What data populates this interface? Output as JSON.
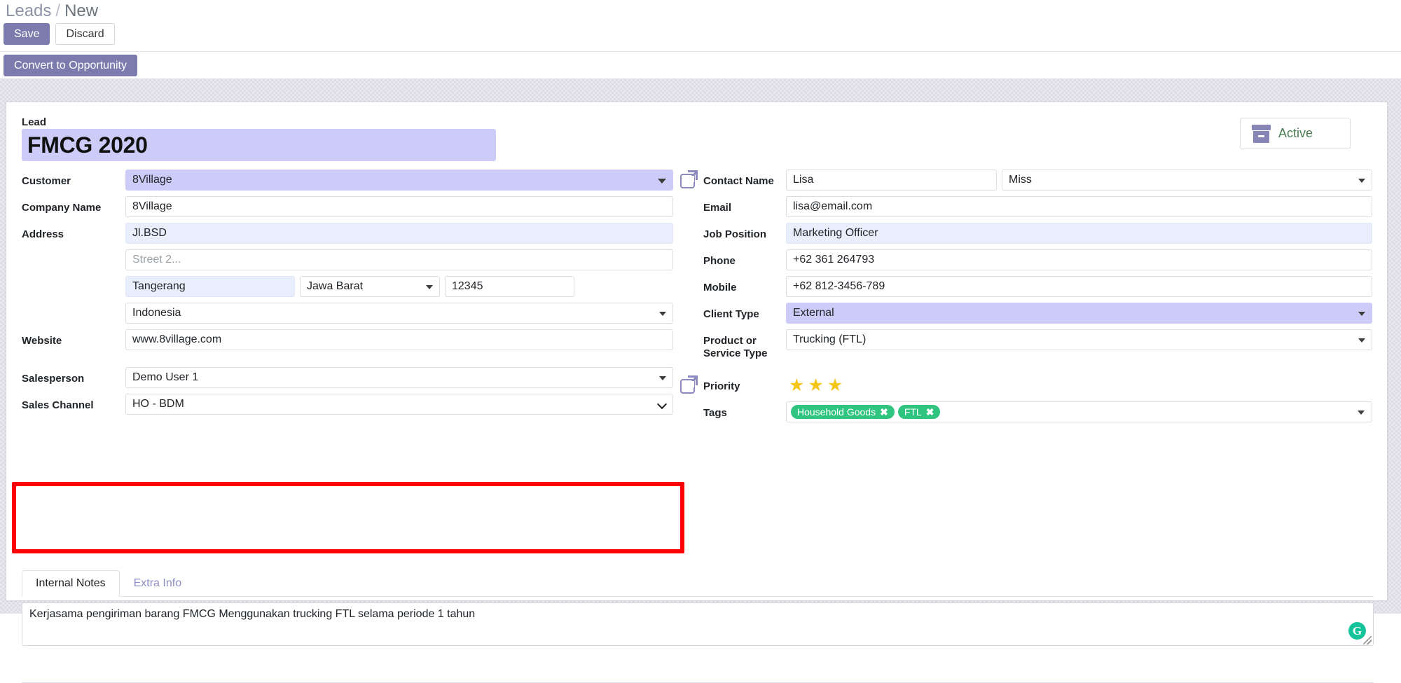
{
  "breadcrumb": {
    "root": "Leads",
    "separator": "/",
    "current": "New"
  },
  "control_panel": {
    "save_label": "Save",
    "discard_label": "Discard"
  },
  "action_bar": {
    "convert_label": "Convert to Opportunity"
  },
  "status": {
    "label": "Active",
    "icon": "archive-box-icon",
    "color": "#4a7a50"
  },
  "lead": {
    "label": "Lead",
    "name": "FMCG 2020"
  },
  "left_column": {
    "customer": {
      "label": "Customer",
      "value": "8Village"
    },
    "company_name": {
      "label": "Company Name",
      "value": "8Village"
    },
    "address": {
      "label": "Address",
      "street": "Jl.BSD",
      "street2_placeholder": "Street 2...",
      "city": "Tangerang",
      "state": "Jawa Barat",
      "zip": "12345",
      "country": "Indonesia"
    },
    "website": {
      "label": "Website",
      "value": "www.8village.com"
    },
    "salesperson": {
      "label": "Salesperson",
      "value": "Demo User 1"
    },
    "sales_channel": {
      "label": "Sales Channel",
      "value": "HO - BDM"
    }
  },
  "right_column": {
    "contact_name": {
      "label": "Contact Name",
      "value": "Lisa",
      "title": "Miss",
      "icon": "external-link-icon"
    },
    "email": {
      "label": "Email",
      "value": "lisa@email.com"
    },
    "job_position": {
      "label": "Job Position",
      "value": "Marketing Officer"
    },
    "phone": {
      "label": "Phone",
      "value": "+62 361 264793"
    },
    "mobile": {
      "label": "Mobile",
      "value": "+62 812-3456-789"
    },
    "client_type": {
      "label": "Client Type",
      "value": "External"
    },
    "product_service_type": {
      "label": "Product or Service Type",
      "value": "Trucking (FTL)"
    },
    "priority": {
      "label": "Priority",
      "stars_filled": 3,
      "stars_total": 3,
      "icon": "external-link-icon",
      "star_color": "#f5c518"
    },
    "tags": {
      "label": "Tags",
      "items": [
        {
          "name": "Household Goods",
          "remove": "✖"
        },
        {
          "name": "FTL",
          "remove": "✖"
        }
      ],
      "color": "#2fc47f"
    }
  },
  "notebook": {
    "tabs": [
      {
        "label": "Internal Notes",
        "active": true
      },
      {
        "label": "Extra Info",
        "active": false
      }
    ],
    "internal_notes": "Kerjasama pengiriman barang FMCG Menggunakan trucking FTL selama periode 1 tahun",
    "grammarly_icon": "G"
  },
  "highlight": {
    "color": "#fb0006"
  }
}
